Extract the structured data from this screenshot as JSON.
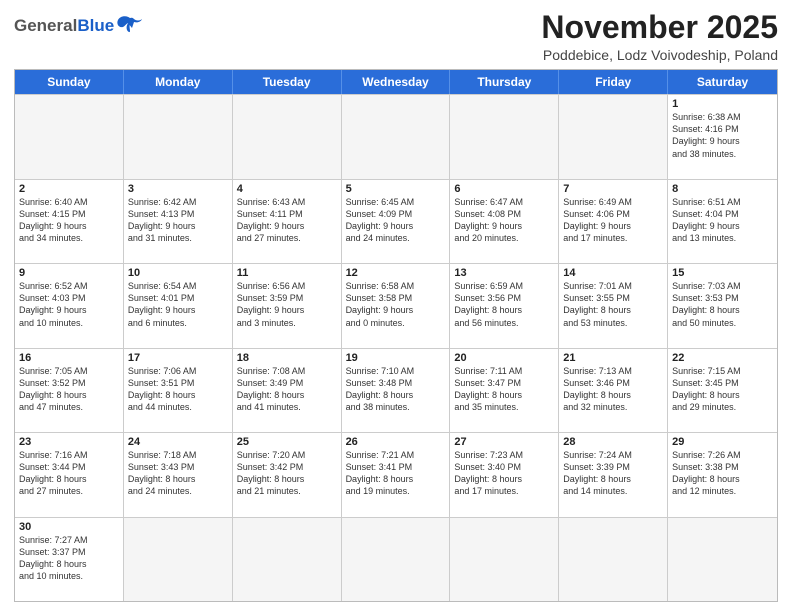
{
  "header": {
    "logo": {
      "general": "General",
      "blue": "Blue"
    },
    "title": "November 2025",
    "location": "Poddebice, Lodz Voivodeship, Poland"
  },
  "weekdays": [
    "Sunday",
    "Monday",
    "Tuesday",
    "Wednesday",
    "Thursday",
    "Friday",
    "Saturday"
  ],
  "weeks": [
    [
      {
        "day": "",
        "info": ""
      },
      {
        "day": "",
        "info": ""
      },
      {
        "day": "",
        "info": ""
      },
      {
        "day": "",
        "info": ""
      },
      {
        "day": "",
        "info": ""
      },
      {
        "day": "",
        "info": ""
      },
      {
        "day": "1",
        "info": "Sunrise: 6:38 AM\nSunset: 4:16 PM\nDaylight: 9 hours\nand 38 minutes."
      }
    ],
    [
      {
        "day": "2",
        "info": "Sunrise: 6:40 AM\nSunset: 4:15 PM\nDaylight: 9 hours\nand 34 minutes."
      },
      {
        "day": "3",
        "info": "Sunrise: 6:42 AM\nSunset: 4:13 PM\nDaylight: 9 hours\nand 31 minutes."
      },
      {
        "day": "4",
        "info": "Sunrise: 6:43 AM\nSunset: 4:11 PM\nDaylight: 9 hours\nand 27 minutes."
      },
      {
        "day": "5",
        "info": "Sunrise: 6:45 AM\nSunset: 4:09 PM\nDaylight: 9 hours\nand 24 minutes."
      },
      {
        "day": "6",
        "info": "Sunrise: 6:47 AM\nSunset: 4:08 PM\nDaylight: 9 hours\nand 20 minutes."
      },
      {
        "day": "7",
        "info": "Sunrise: 6:49 AM\nSunset: 4:06 PM\nDaylight: 9 hours\nand 17 minutes."
      },
      {
        "day": "8",
        "info": "Sunrise: 6:51 AM\nSunset: 4:04 PM\nDaylight: 9 hours\nand 13 minutes."
      }
    ],
    [
      {
        "day": "9",
        "info": "Sunrise: 6:52 AM\nSunset: 4:03 PM\nDaylight: 9 hours\nand 10 minutes."
      },
      {
        "day": "10",
        "info": "Sunrise: 6:54 AM\nSunset: 4:01 PM\nDaylight: 9 hours\nand 6 minutes."
      },
      {
        "day": "11",
        "info": "Sunrise: 6:56 AM\nSunset: 3:59 PM\nDaylight: 9 hours\nand 3 minutes."
      },
      {
        "day": "12",
        "info": "Sunrise: 6:58 AM\nSunset: 3:58 PM\nDaylight: 9 hours\nand 0 minutes."
      },
      {
        "day": "13",
        "info": "Sunrise: 6:59 AM\nSunset: 3:56 PM\nDaylight: 8 hours\nand 56 minutes."
      },
      {
        "day": "14",
        "info": "Sunrise: 7:01 AM\nSunset: 3:55 PM\nDaylight: 8 hours\nand 53 minutes."
      },
      {
        "day": "15",
        "info": "Sunrise: 7:03 AM\nSunset: 3:53 PM\nDaylight: 8 hours\nand 50 minutes."
      }
    ],
    [
      {
        "day": "16",
        "info": "Sunrise: 7:05 AM\nSunset: 3:52 PM\nDaylight: 8 hours\nand 47 minutes."
      },
      {
        "day": "17",
        "info": "Sunrise: 7:06 AM\nSunset: 3:51 PM\nDaylight: 8 hours\nand 44 minutes."
      },
      {
        "day": "18",
        "info": "Sunrise: 7:08 AM\nSunset: 3:49 PM\nDaylight: 8 hours\nand 41 minutes."
      },
      {
        "day": "19",
        "info": "Sunrise: 7:10 AM\nSunset: 3:48 PM\nDaylight: 8 hours\nand 38 minutes."
      },
      {
        "day": "20",
        "info": "Sunrise: 7:11 AM\nSunset: 3:47 PM\nDaylight: 8 hours\nand 35 minutes."
      },
      {
        "day": "21",
        "info": "Sunrise: 7:13 AM\nSunset: 3:46 PM\nDaylight: 8 hours\nand 32 minutes."
      },
      {
        "day": "22",
        "info": "Sunrise: 7:15 AM\nSunset: 3:45 PM\nDaylight: 8 hours\nand 29 minutes."
      }
    ],
    [
      {
        "day": "23",
        "info": "Sunrise: 7:16 AM\nSunset: 3:44 PM\nDaylight: 8 hours\nand 27 minutes."
      },
      {
        "day": "24",
        "info": "Sunrise: 7:18 AM\nSunset: 3:43 PM\nDaylight: 8 hours\nand 24 minutes."
      },
      {
        "day": "25",
        "info": "Sunrise: 7:20 AM\nSunset: 3:42 PM\nDaylight: 8 hours\nand 21 minutes."
      },
      {
        "day": "26",
        "info": "Sunrise: 7:21 AM\nSunset: 3:41 PM\nDaylight: 8 hours\nand 19 minutes."
      },
      {
        "day": "27",
        "info": "Sunrise: 7:23 AM\nSunset: 3:40 PM\nDaylight: 8 hours\nand 17 minutes."
      },
      {
        "day": "28",
        "info": "Sunrise: 7:24 AM\nSunset: 3:39 PM\nDaylight: 8 hours\nand 14 minutes."
      },
      {
        "day": "29",
        "info": "Sunrise: 7:26 AM\nSunset: 3:38 PM\nDaylight: 8 hours\nand 12 minutes."
      }
    ],
    [
      {
        "day": "30",
        "info": "Sunrise: 7:27 AM\nSunset: 3:37 PM\nDaylight: 8 hours\nand 10 minutes."
      },
      {
        "day": "",
        "info": ""
      },
      {
        "day": "",
        "info": ""
      },
      {
        "day": "",
        "info": ""
      },
      {
        "day": "",
        "info": ""
      },
      {
        "day": "",
        "info": ""
      },
      {
        "day": "",
        "info": ""
      }
    ]
  ]
}
